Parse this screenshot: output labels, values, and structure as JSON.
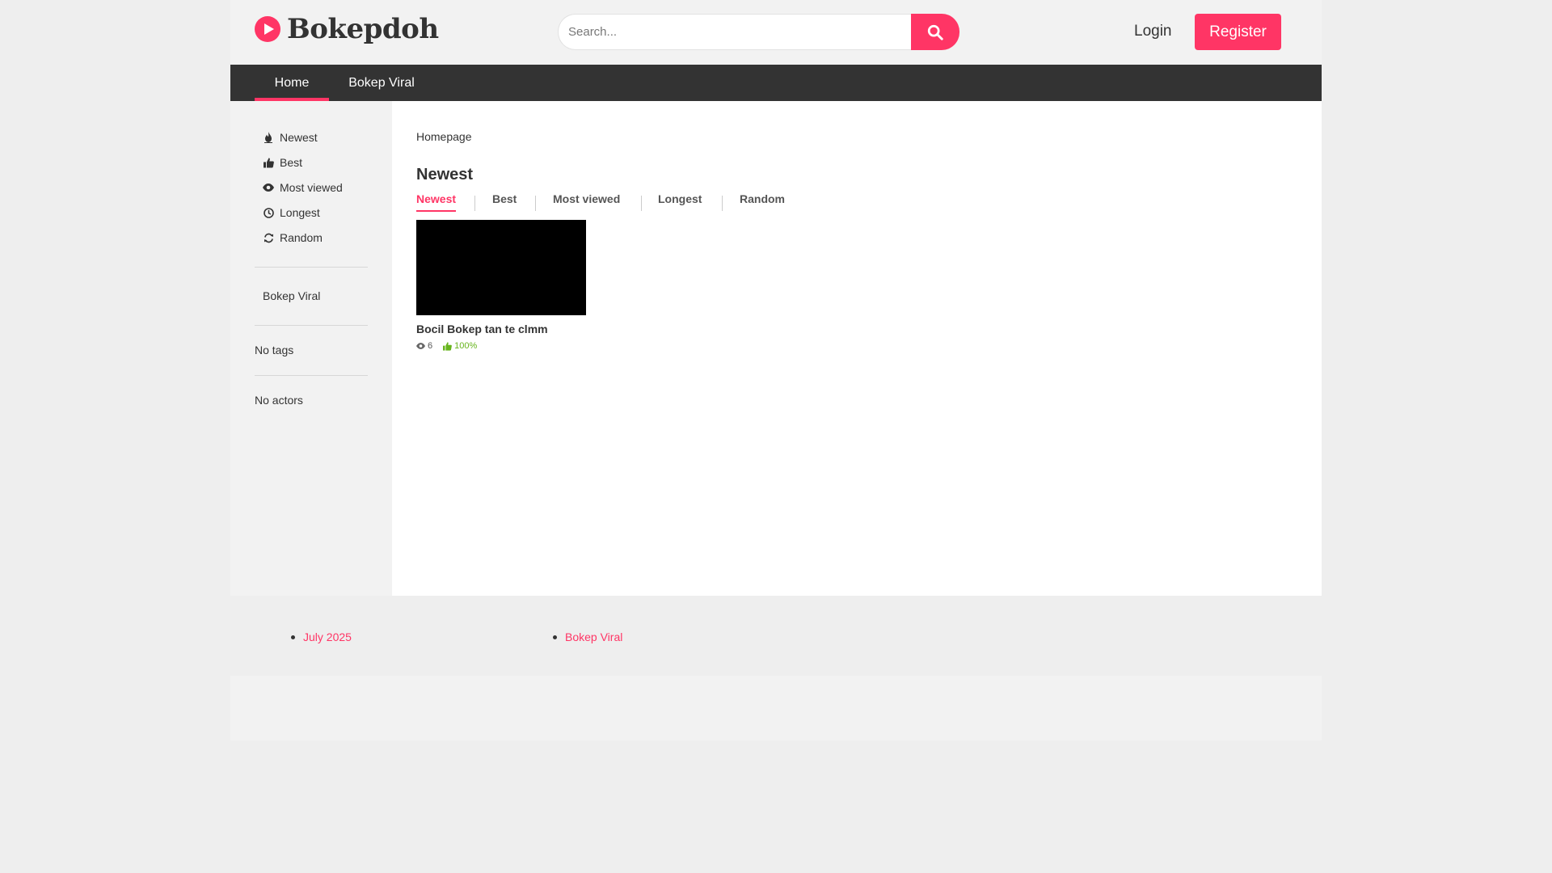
{
  "header": {
    "logo_text": "Bokepdoh",
    "search_placeholder": "Search...",
    "login_label": "Login",
    "register_label": "Register",
    "accent_color": "#ff3565"
  },
  "nav": {
    "items": [
      {
        "label": "Home",
        "active": true
      },
      {
        "label": "Bokep Viral",
        "active": false
      }
    ]
  },
  "sidebar": {
    "sort_items": [
      {
        "label": "Newest",
        "icon": "fire-icon"
      },
      {
        "label": "Best",
        "icon": "thumbs-up-icon"
      },
      {
        "label": "Most viewed",
        "icon": "eye-icon"
      },
      {
        "label": "Longest",
        "icon": "clock-icon"
      },
      {
        "label": "Random",
        "icon": "refresh-icon"
      }
    ],
    "category": "Bokep Viral",
    "tags_text": "No tags",
    "actors_text": "No actors"
  },
  "main": {
    "breadcrumb": "Homepage",
    "section_title": "Newest",
    "tabs": [
      {
        "label": "Newest",
        "active": true
      },
      {
        "label": "Best",
        "active": false
      },
      {
        "label": "Most viewed",
        "active": false
      },
      {
        "label": "Longest",
        "active": false
      },
      {
        "label": "Random",
        "active": false
      }
    ],
    "videos": [
      {
        "title": "Bocil Bokep tan te clmm",
        "views": "6",
        "rating": "100%"
      }
    ]
  },
  "footer": {
    "links": [
      {
        "label": "July 2025"
      },
      {
        "label": "Bokep Viral"
      }
    ]
  }
}
